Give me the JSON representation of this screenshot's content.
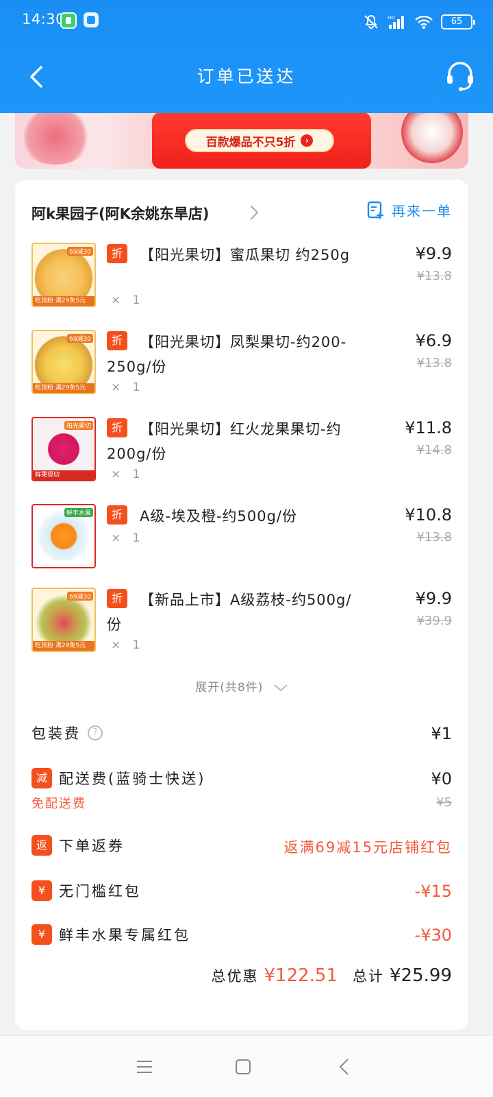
{
  "status": {
    "time": "14:30",
    "battery": "65"
  },
  "nav": {
    "title": "订单已送达"
  },
  "banner": {
    "cta": "百款爆品不只5折"
  },
  "shop": {
    "name": "阿k果园子(阿K余姚东旱店)",
    "reorder": "再来一单"
  },
  "items": [
    {
      "badge": "折",
      "name": "【阳光果切】蜜瓜果切 约250g",
      "qty": "× 1",
      "price": "¥9.9",
      "orig": "¥13.8",
      "thumb_tag": "69减30",
      "thumb_label": "吃货粉 满29免5元"
    },
    {
      "badge": "折",
      "name": "【阳光果切】凤梨果切-约200-250g/份",
      "qty": "× 1",
      "price": "¥6.9",
      "orig": "¥13.8",
      "thumb_tag": "69减30",
      "thumb_label": "吃货粉 满29免5元"
    },
    {
      "badge": "折",
      "name": "【阳光果切】红火龙果果切-约200g/份",
      "qty": "× 1",
      "price": "¥11.8",
      "orig": "¥14.8",
      "thumb_tag": "阳光果切",
      "thumb_label": "鲜果现切"
    },
    {
      "badge": "折",
      "name": "A级-埃及橙-约500g/份",
      "qty": "× 1",
      "price": "¥10.8",
      "orig": "¥13.8",
      "thumb_tag": "鲜丰水果",
      "thumb_label": ""
    },
    {
      "badge": "折",
      "name": "【新品上市】A级荔枝-约500g/份",
      "qty": "× 1",
      "price": "¥9.9",
      "orig": "¥39.9",
      "thumb_tag": "69减30",
      "thumb_label": "吃货粉 满29免5元"
    }
  ],
  "expand": {
    "label": "展开(共8件)"
  },
  "fees": {
    "packaging": {
      "label": "包装费",
      "value": "¥1"
    },
    "delivery": {
      "tag": "减",
      "label": "配送费(蓝骑士快送)",
      "value": "¥0",
      "sub": "免配送费",
      "orig": "¥5"
    },
    "coupon_return": {
      "tag": "返",
      "label": "下单返券",
      "value": "返满69减15元店铺红包"
    },
    "no_threshold": {
      "tag": "¥",
      "label": "无门槛红包",
      "value": "-¥15"
    },
    "exclusive": {
      "tag": "¥",
      "label": "鲜丰水果专属红包",
      "value": "-¥30"
    }
  },
  "totals": {
    "discount_label": "总优惠",
    "discount": "¥122.51",
    "total_label": "总计",
    "total": "¥25.99"
  },
  "colors": {
    "brand_blue": "#1d96f9",
    "accent_orange": "#f4501e",
    "discount_red": "#f25a3a"
  }
}
